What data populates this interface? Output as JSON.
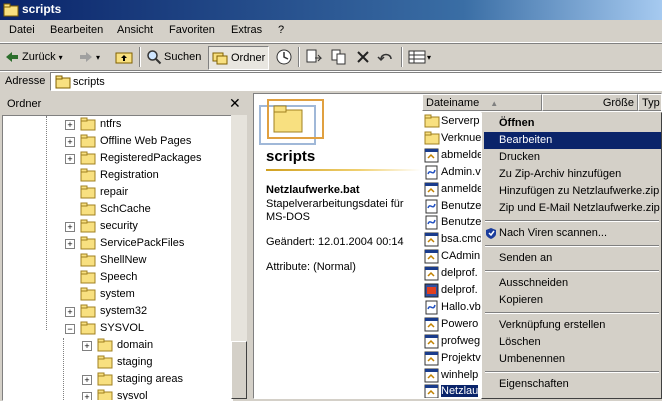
{
  "window": {
    "title": "scripts"
  },
  "menu": [
    "Datei",
    "Bearbeiten",
    "Ansicht",
    "Favoriten",
    "Extras",
    "?"
  ],
  "toolbar": {
    "back": "Zurück",
    "search": "Suchen",
    "folders": "Ordner"
  },
  "address": {
    "label": "Adresse",
    "value": "scripts"
  },
  "folder_pane": {
    "title": "Ordner",
    "items": [
      {
        "label": "ntfrs",
        "expand": "+"
      },
      {
        "label": "Offline Web Pages",
        "expand": "+"
      },
      {
        "label": "RegisteredPackages",
        "expand": "+"
      },
      {
        "label": "Registration",
        "expand": ""
      },
      {
        "label": "repair",
        "expand": ""
      },
      {
        "label": "SchCache",
        "expand": ""
      },
      {
        "label": "security",
        "expand": "+"
      },
      {
        "label": "ServicePackFiles",
        "expand": "+"
      },
      {
        "label": "ShellNew",
        "expand": ""
      },
      {
        "label": "Speech",
        "expand": ""
      },
      {
        "label": "system",
        "expand": ""
      },
      {
        "label": "system32",
        "expand": "+"
      },
      {
        "label": "SYSVOL",
        "expand": "-"
      },
      {
        "label": "domain",
        "expand": "+"
      },
      {
        "label": "staging",
        "expand": ""
      },
      {
        "label": "staging areas",
        "expand": "+"
      },
      {
        "label": "sysvol",
        "expand": "+"
      }
    ]
  },
  "webview": {
    "folder_title": "scripts",
    "file_name": "Netzlaufwerke.bat",
    "file_type_line1": "Stapelverarbeitungsdatei für",
    "file_type_line2": "MS-DOS",
    "modified": "Geändert: 12.01.2004 00:14",
    "attributes": "Attribute: (Normal)"
  },
  "columns": [
    "Dateiname",
    "Größe",
    "Typ"
  ],
  "files": [
    {
      "name": "Serverp",
      "icon": "folder"
    },
    {
      "name": "Verknue",
      "icon": "folder"
    },
    {
      "name": "abmelde",
      "icon": "batch"
    },
    {
      "name": "Admin.v",
      "icon": "script"
    },
    {
      "name": "anmelde",
      "icon": "batch"
    },
    {
      "name": "Benutze",
      "icon": "script"
    },
    {
      "name": "Benutze",
      "icon": "script"
    },
    {
      "name": "bsa.cmd",
      "icon": "batch"
    },
    {
      "name": "CAdmin",
      "icon": "batch"
    },
    {
      "name": "delprof.",
      "icon": "batch"
    },
    {
      "name": "delprof.",
      "icon": "exe"
    },
    {
      "name": "Hallo.vb",
      "icon": "script"
    },
    {
      "name": "Powero",
      "icon": "batch"
    },
    {
      "name": "profweg",
      "icon": "batch"
    },
    {
      "name": "Projektv",
      "icon": "batch"
    },
    {
      "name": "winhelp",
      "icon": "batch"
    },
    {
      "name": "Netzlau",
      "icon": "batch",
      "selected": true
    }
  ],
  "context_menu": [
    {
      "label": "Öffnen",
      "bold": true
    },
    {
      "label": "Bearbeiten",
      "highlight": true
    },
    {
      "label": "Drucken"
    },
    {
      "label": "Zu Zip-Archiv hinzufügen"
    },
    {
      "label": "Hinzufügen zu Netzlaufwerke.zip"
    },
    {
      "label": "Zip und E-Mail Netzlaufwerke.zip"
    },
    {
      "sep": true
    },
    {
      "label": "Nach Viren scannen...",
      "icon": "shield-icon"
    },
    {
      "sep": true
    },
    {
      "label": "Senden an"
    },
    {
      "sep": true
    },
    {
      "label": "Ausschneiden"
    },
    {
      "label": "Kopieren"
    },
    {
      "sep": true
    },
    {
      "label": "Verknüpfung erstellen"
    },
    {
      "label": "Löschen"
    },
    {
      "label": "Umbenennen"
    },
    {
      "sep": true
    },
    {
      "label": "Eigenschaften"
    }
  ],
  "colors": {
    "title_active": "#0a246a",
    "face": "#d4d0c8",
    "highlight": "#0a246a",
    "folder": "#f8e080"
  }
}
